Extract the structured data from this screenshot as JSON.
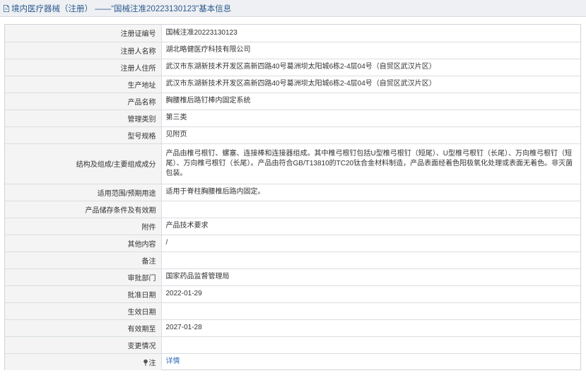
{
  "header": {
    "title": "境内医疗器械（注册） ——“国械注准20223130123”基本信息"
  },
  "rows": [
    {
      "label": "注册证编号",
      "value": "国械注准20223130123"
    },
    {
      "label": "注册人名称",
      "value": "湖北略健医疗科技有限公司"
    },
    {
      "label": "注册人住所",
      "value": "武汉市东湖新技术开发区高新四路40号葛洲坝太阳城6栋2-4层04号（自贸区武汉片区）"
    },
    {
      "label": "生产地址",
      "value": "武汉市东湖新技术开发区高新四路40号葛洲坝太阳城6栋2-4层04号（自贸区武汉片区）"
    },
    {
      "label": "产品名称",
      "value": "胸腰椎后路钉棒内固定系统"
    },
    {
      "label": "管理类别",
      "value": "第三类"
    },
    {
      "label": "型号规格",
      "value": "见附页"
    },
    {
      "label": "结构及组成/主要组成成分",
      "value": "产品由椎弓根钉、螺塞、连接棒和连接器组成。其中椎弓根钉包括U型椎弓根钉（短尾）、U型椎弓根钉（长尾）、万向椎弓根钉（短尾）、万向椎弓根钉（长尾）。产品由符合GB/T13810的TC20钛合金材料制造，产品表面经着色阳极氧化处理或表面无着色。非灭菌包装。"
    },
    {
      "label": "适用范围/预期用途",
      "value": "适用于脊柱胸腰椎后路内固定。"
    },
    {
      "label": "产品储存条件及有效期",
      "value": ""
    },
    {
      "label": "附件",
      "value": "产品技术要求"
    },
    {
      "label": "其他内容",
      "value": "/"
    },
    {
      "label": "备注",
      "value": ""
    },
    {
      "label": "审批部门",
      "value": "国家药品监督管理局"
    },
    {
      "label": "批准日期",
      "value": "2022-01-29"
    },
    {
      "label": "生效日期",
      "value": ""
    },
    {
      "label": "有效期至",
      "value": "2027-01-28"
    },
    {
      "label": "变更情况",
      "value": ""
    }
  ],
  "note_row": {
    "label": "注",
    "link": "详情",
    "icon": "note-icon"
  },
  "colors": {
    "header_bg": "#eef0f3",
    "title": "#2d5a8e",
    "label_bg": "#f4f4f4",
    "link": "#2d6db5",
    "border": "#d9dde2"
  }
}
